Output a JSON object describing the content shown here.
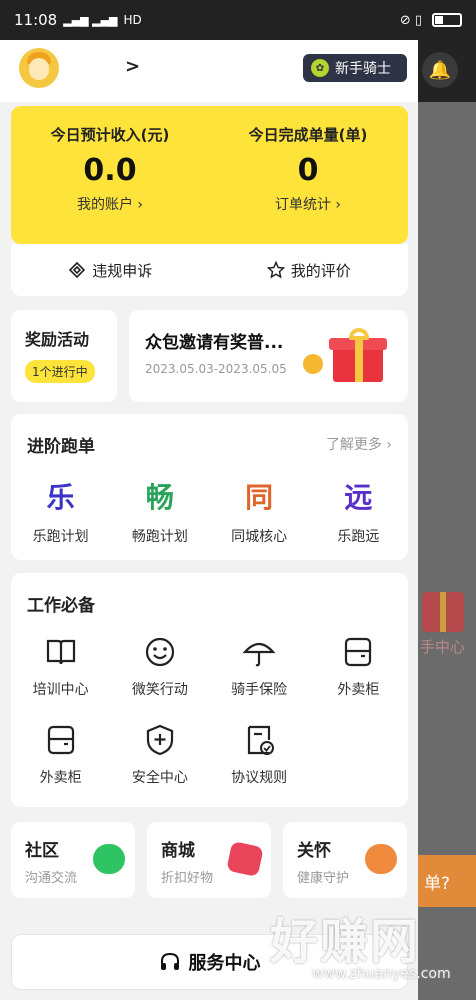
{
  "statusbar": {
    "time": "11:08",
    "signal": "▂▄▆ ▂▄▆",
    "network": "HD",
    "icons_right": "⊘ ▯"
  },
  "header": {
    "avatar_icon": "rider-avatar-icon",
    "chevron": ">",
    "badge_label": "新手骑士",
    "badge_icon": "sprout-icon"
  },
  "income": {
    "left": {
      "label": "今日预计收入(元)",
      "value": "0.0",
      "link": "我的账户 ›"
    },
    "right": {
      "label": "今日完成单量(单)",
      "value": "0",
      "link": "订单统计 ›"
    }
  },
  "actions": {
    "appeal": "违规申诉",
    "rating": "我的评价"
  },
  "reward": {
    "title": "奖励活动",
    "status": "1个进行中"
  },
  "promo": {
    "title": "众包邀请有奖普...",
    "date": "2023.05.03-2023.05.05"
  },
  "advanced": {
    "title": "进阶跑单",
    "more": "了解更多 ›",
    "items": [
      {
        "char": "乐",
        "label": "乐跑计划",
        "color": "#3b34c7"
      },
      {
        "char": "畅",
        "label": "畅跑计划",
        "color": "#29a35a"
      },
      {
        "char": "同",
        "label": "同城核心",
        "color": "#e0652c"
      },
      {
        "char": "远",
        "label": "乐跑远",
        "color": "#5a2fc9"
      }
    ]
  },
  "work": {
    "title": "工作必备",
    "row1": [
      {
        "label": "培训中心",
        "icon": "book-icon"
      },
      {
        "label": "微笑行动",
        "icon": "smile-icon"
      },
      {
        "label": "骑手保险",
        "icon": "umbrella-icon"
      },
      {
        "label": "外卖柜",
        "icon": "locker-icon"
      }
    ],
    "row2": [
      {
        "label": "外卖柜",
        "icon": "locker-icon"
      },
      {
        "label": "安全中心",
        "icon": "shield-icon"
      },
      {
        "label": "协议规则",
        "icon": "document-check-icon"
      }
    ]
  },
  "bottom_cards": [
    {
      "title": "社区",
      "subtitle": "沟通交流",
      "icon": "chat-icon",
      "color": "#2fc463"
    },
    {
      "title": "商城",
      "subtitle": "折扣好物",
      "icon": "shop-tag-icon",
      "color": "#e8455a"
    },
    {
      "title": "关怀",
      "subtitle": "健康守护",
      "icon": "heart-icon",
      "color": "#f08a3c"
    }
  ],
  "service": {
    "label": "服务中心",
    "icon": "headset-icon"
  },
  "background": {
    "gift_label": "手中心",
    "order_label": "单?",
    "bell_icon": "bell-icon"
  },
  "watermark": {
    "text": "好赚网",
    "url": "www.zhuanyes.com"
  }
}
